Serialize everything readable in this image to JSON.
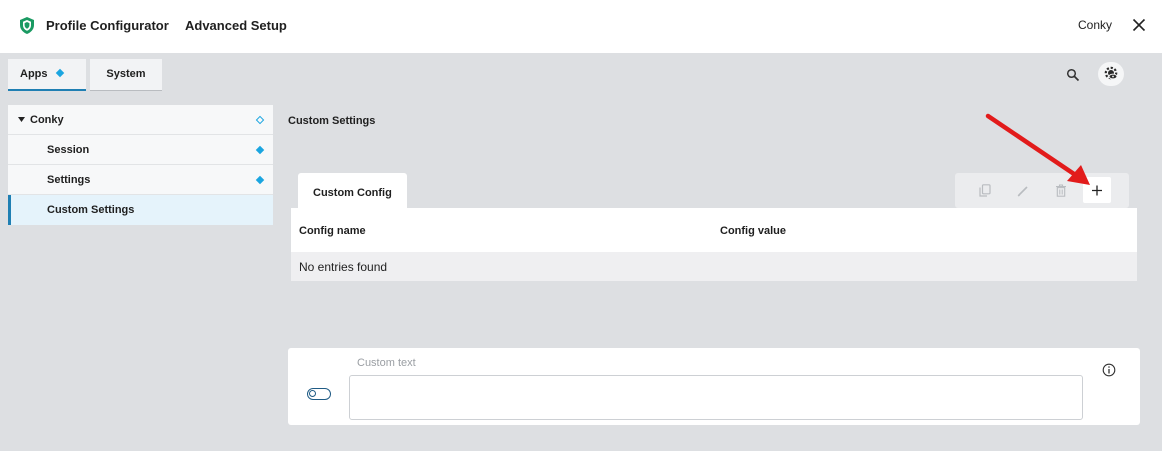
{
  "app": {
    "title": "Profile Configurator",
    "page": "Advanced Setup",
    "user": "Conky",
    "brand_color": "#1a9a62"
  },
  "main_tabs": [
    {
      "label": "Apps",
      "active": true,
      "icon": "diamond-icon"
    },
    {
      "label": "System",
      "active": false
    }
  ],
  "sidebar": {
    "group": {
      "label": "Conky",
      "icon": "hollow-diamond-icon"
    },
    "items": [
      {
        "label": "Session",
        "icon": "diamond-icon"
      },
      {
        "label": "Settings",
        "icon": "diamond-icon"
      },
      {
        "label": "Custom Settings",
        "selected": true
      }
    ]
  },
  "section_title": "Custom Settings",
  "custom_config": {
    "tab_label": "Custom Config",
    "toolbar": [
      "copy-icon",
      "edit-icon",
      "delete-icon",
      "add-icon"
    ],
    "columns": [
      "Config name",
      "Config value"
    ],
    "empty_text": "No entries found"
  },
  "custom_text": {
    "label": "Custom text",
    "value": "",
    "enabled": false
  },
  "annotation": {
    "arrow_color": "#e21b1b",
    "points_to": "add-icon"
  },
  "colors": {
    "accent": "#1f7fb3",
    "diamond": "#1ba5e0"
  }
}
